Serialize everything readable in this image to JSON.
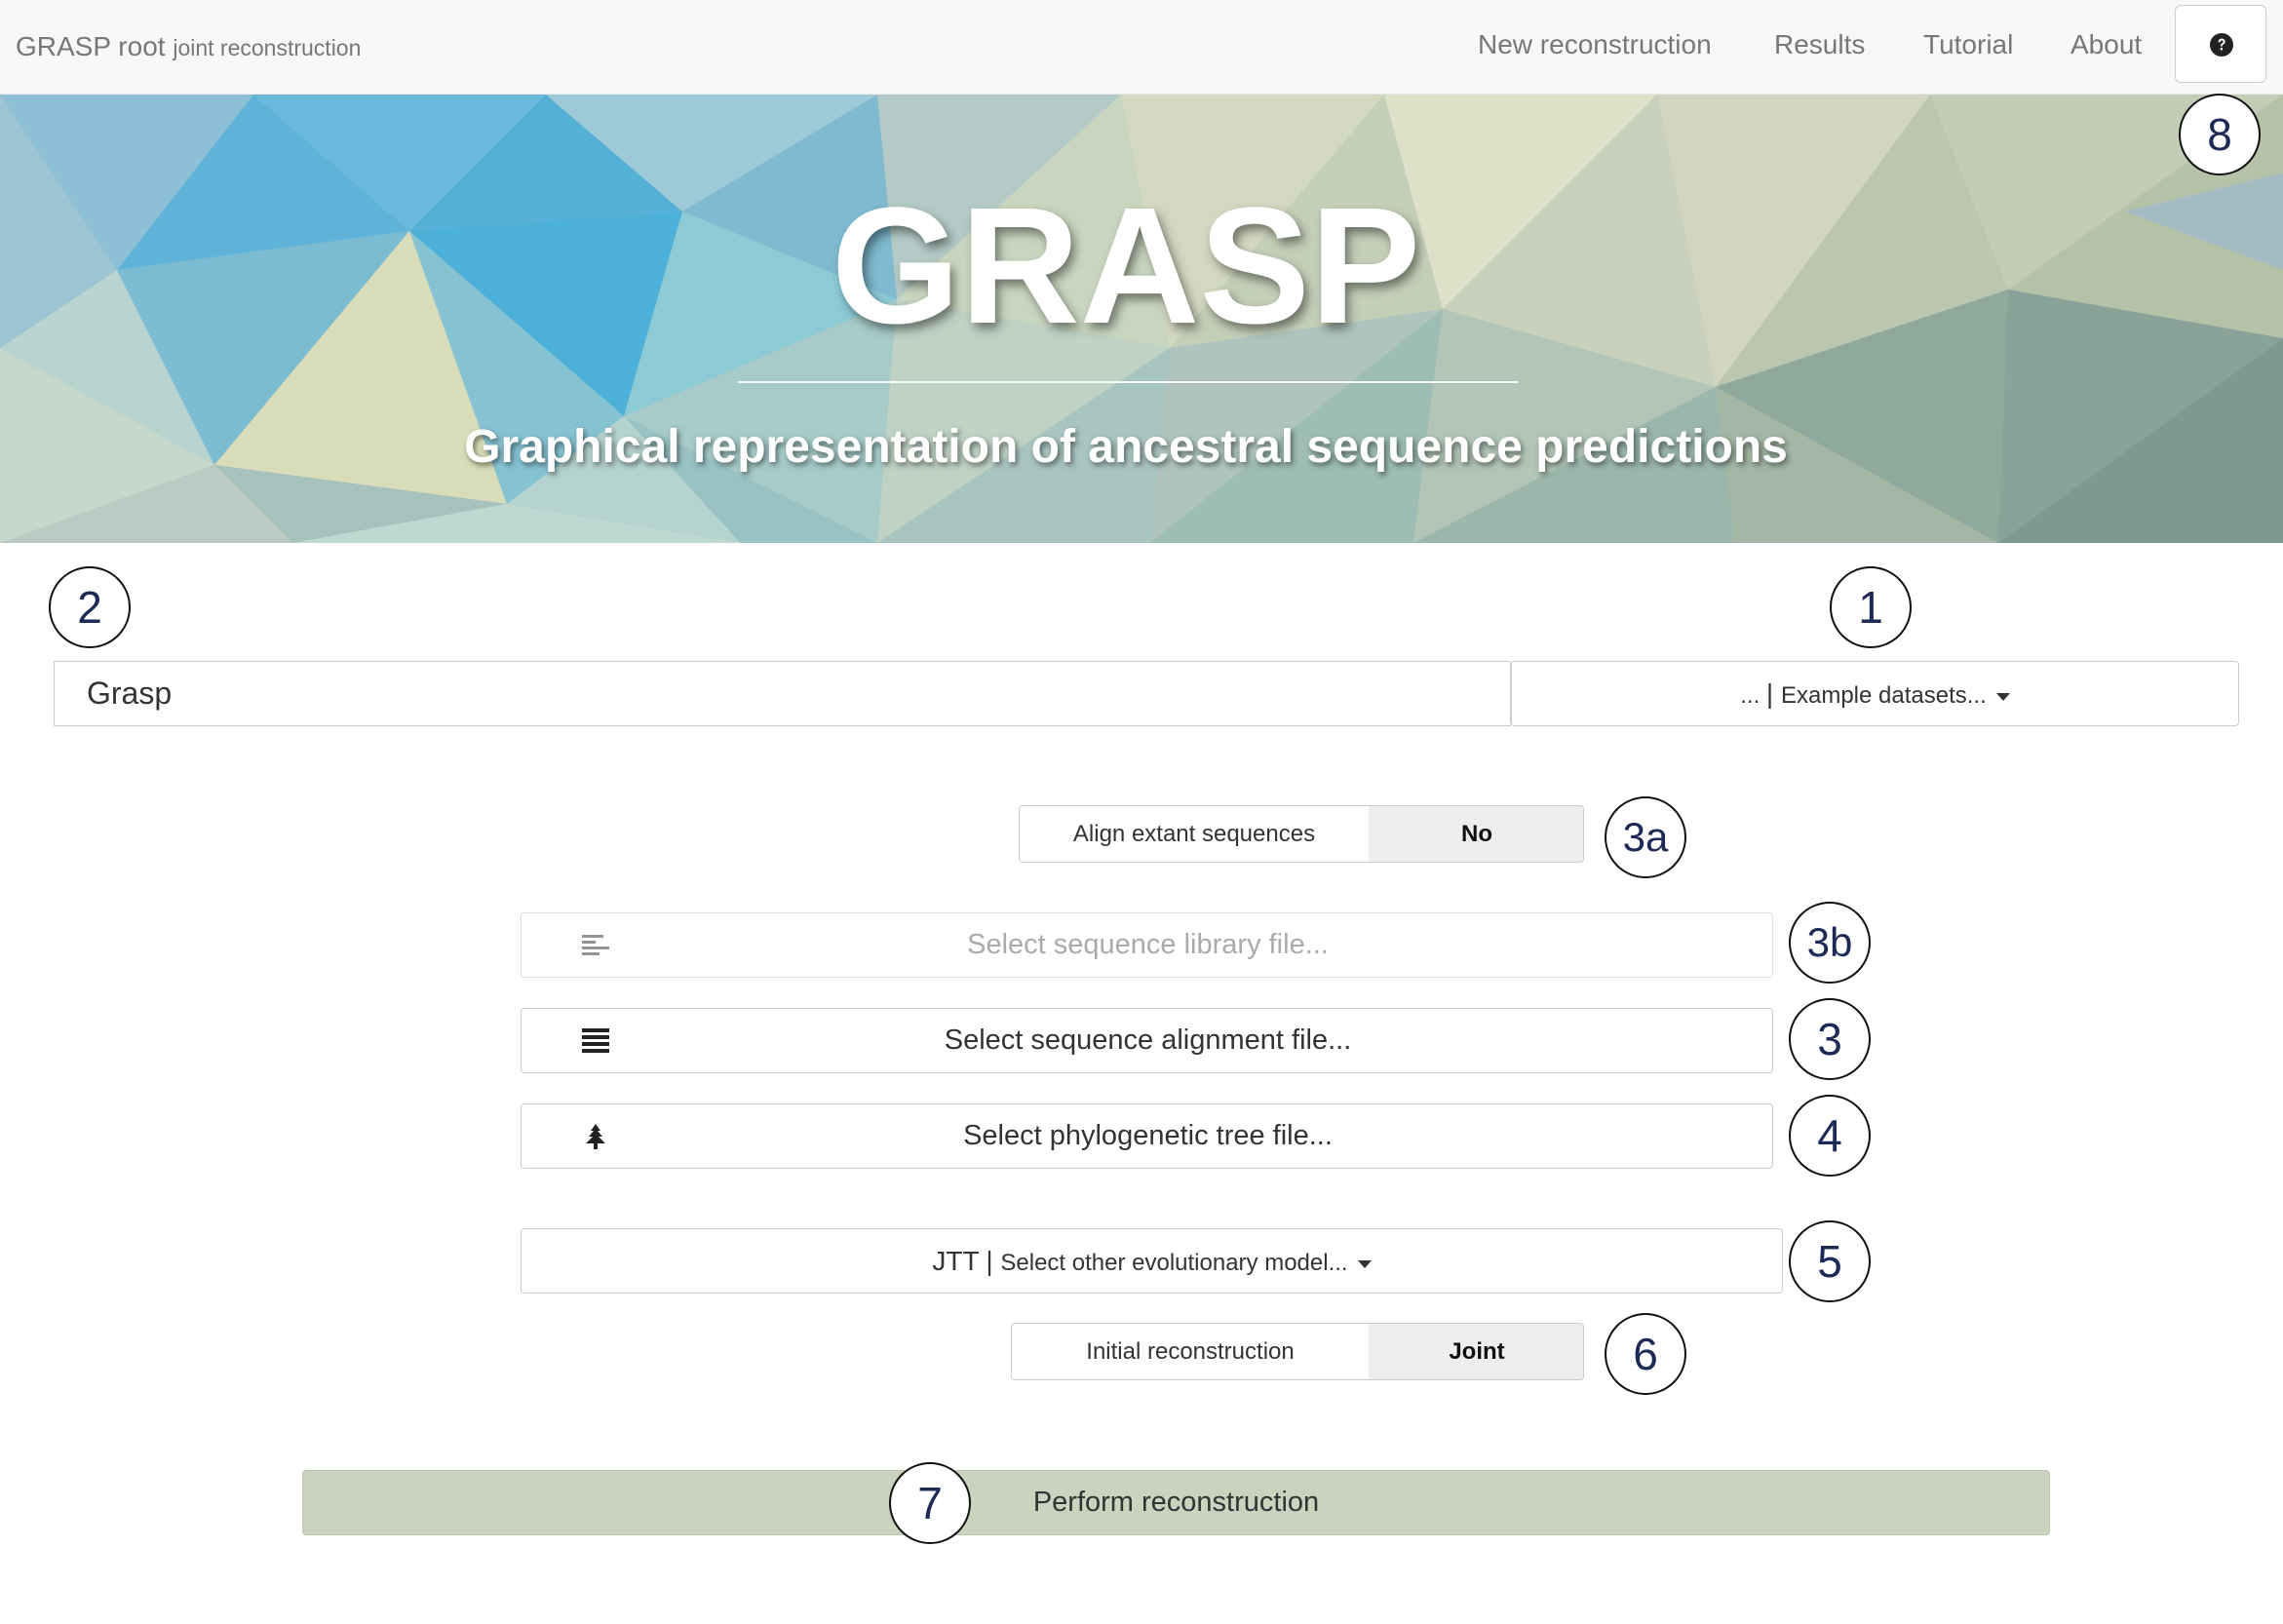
{
  "navbar": {
    "brand_main": "GRASP root",
    "brand_sub": "joint reconstruction",
    "links": [
      "New reconstruction",
      "Results",
      "Tutorial",
      "About"
    ],
    "help_icon": "question-circle-icon"
  },
  "hero": {
    "title": "GRASP",
    "subtitle": "Graphical representation of ancestral sequence predictions"
  },
  "form": {
    "name_value": "Grasp",
    "dataset_prefix": "...",
    "dataset_label": "Example datasets...",
    "align_label": "Align extant sequences",
    "align_value": "No",
    "library_placeholder": "Select sequence library file...",
    "alignment_label": "Select sequence alignment file...",
    "tree_label": "Select phylogenetic tree file...",
    "model_current": "JTT",
    "model_label": "Select other evolutionary model...",
    "recon_label": "Initial reconstruction",
    "recon_value": "Joint",
    "perform_label": "Perform reconstruction"
  },
  "callouts": [
    "8",
    "2",
    "1",
    "3a",
    "3b",
    "3",
    "4",
    "5",
    "6",
    "7"
  ],
  "colors": {
    "navbar_bg": "#f8f8f8",
    "perform_bg": "#c9d3bd",
    "callout_text": "#1e2a56"
  }
}
